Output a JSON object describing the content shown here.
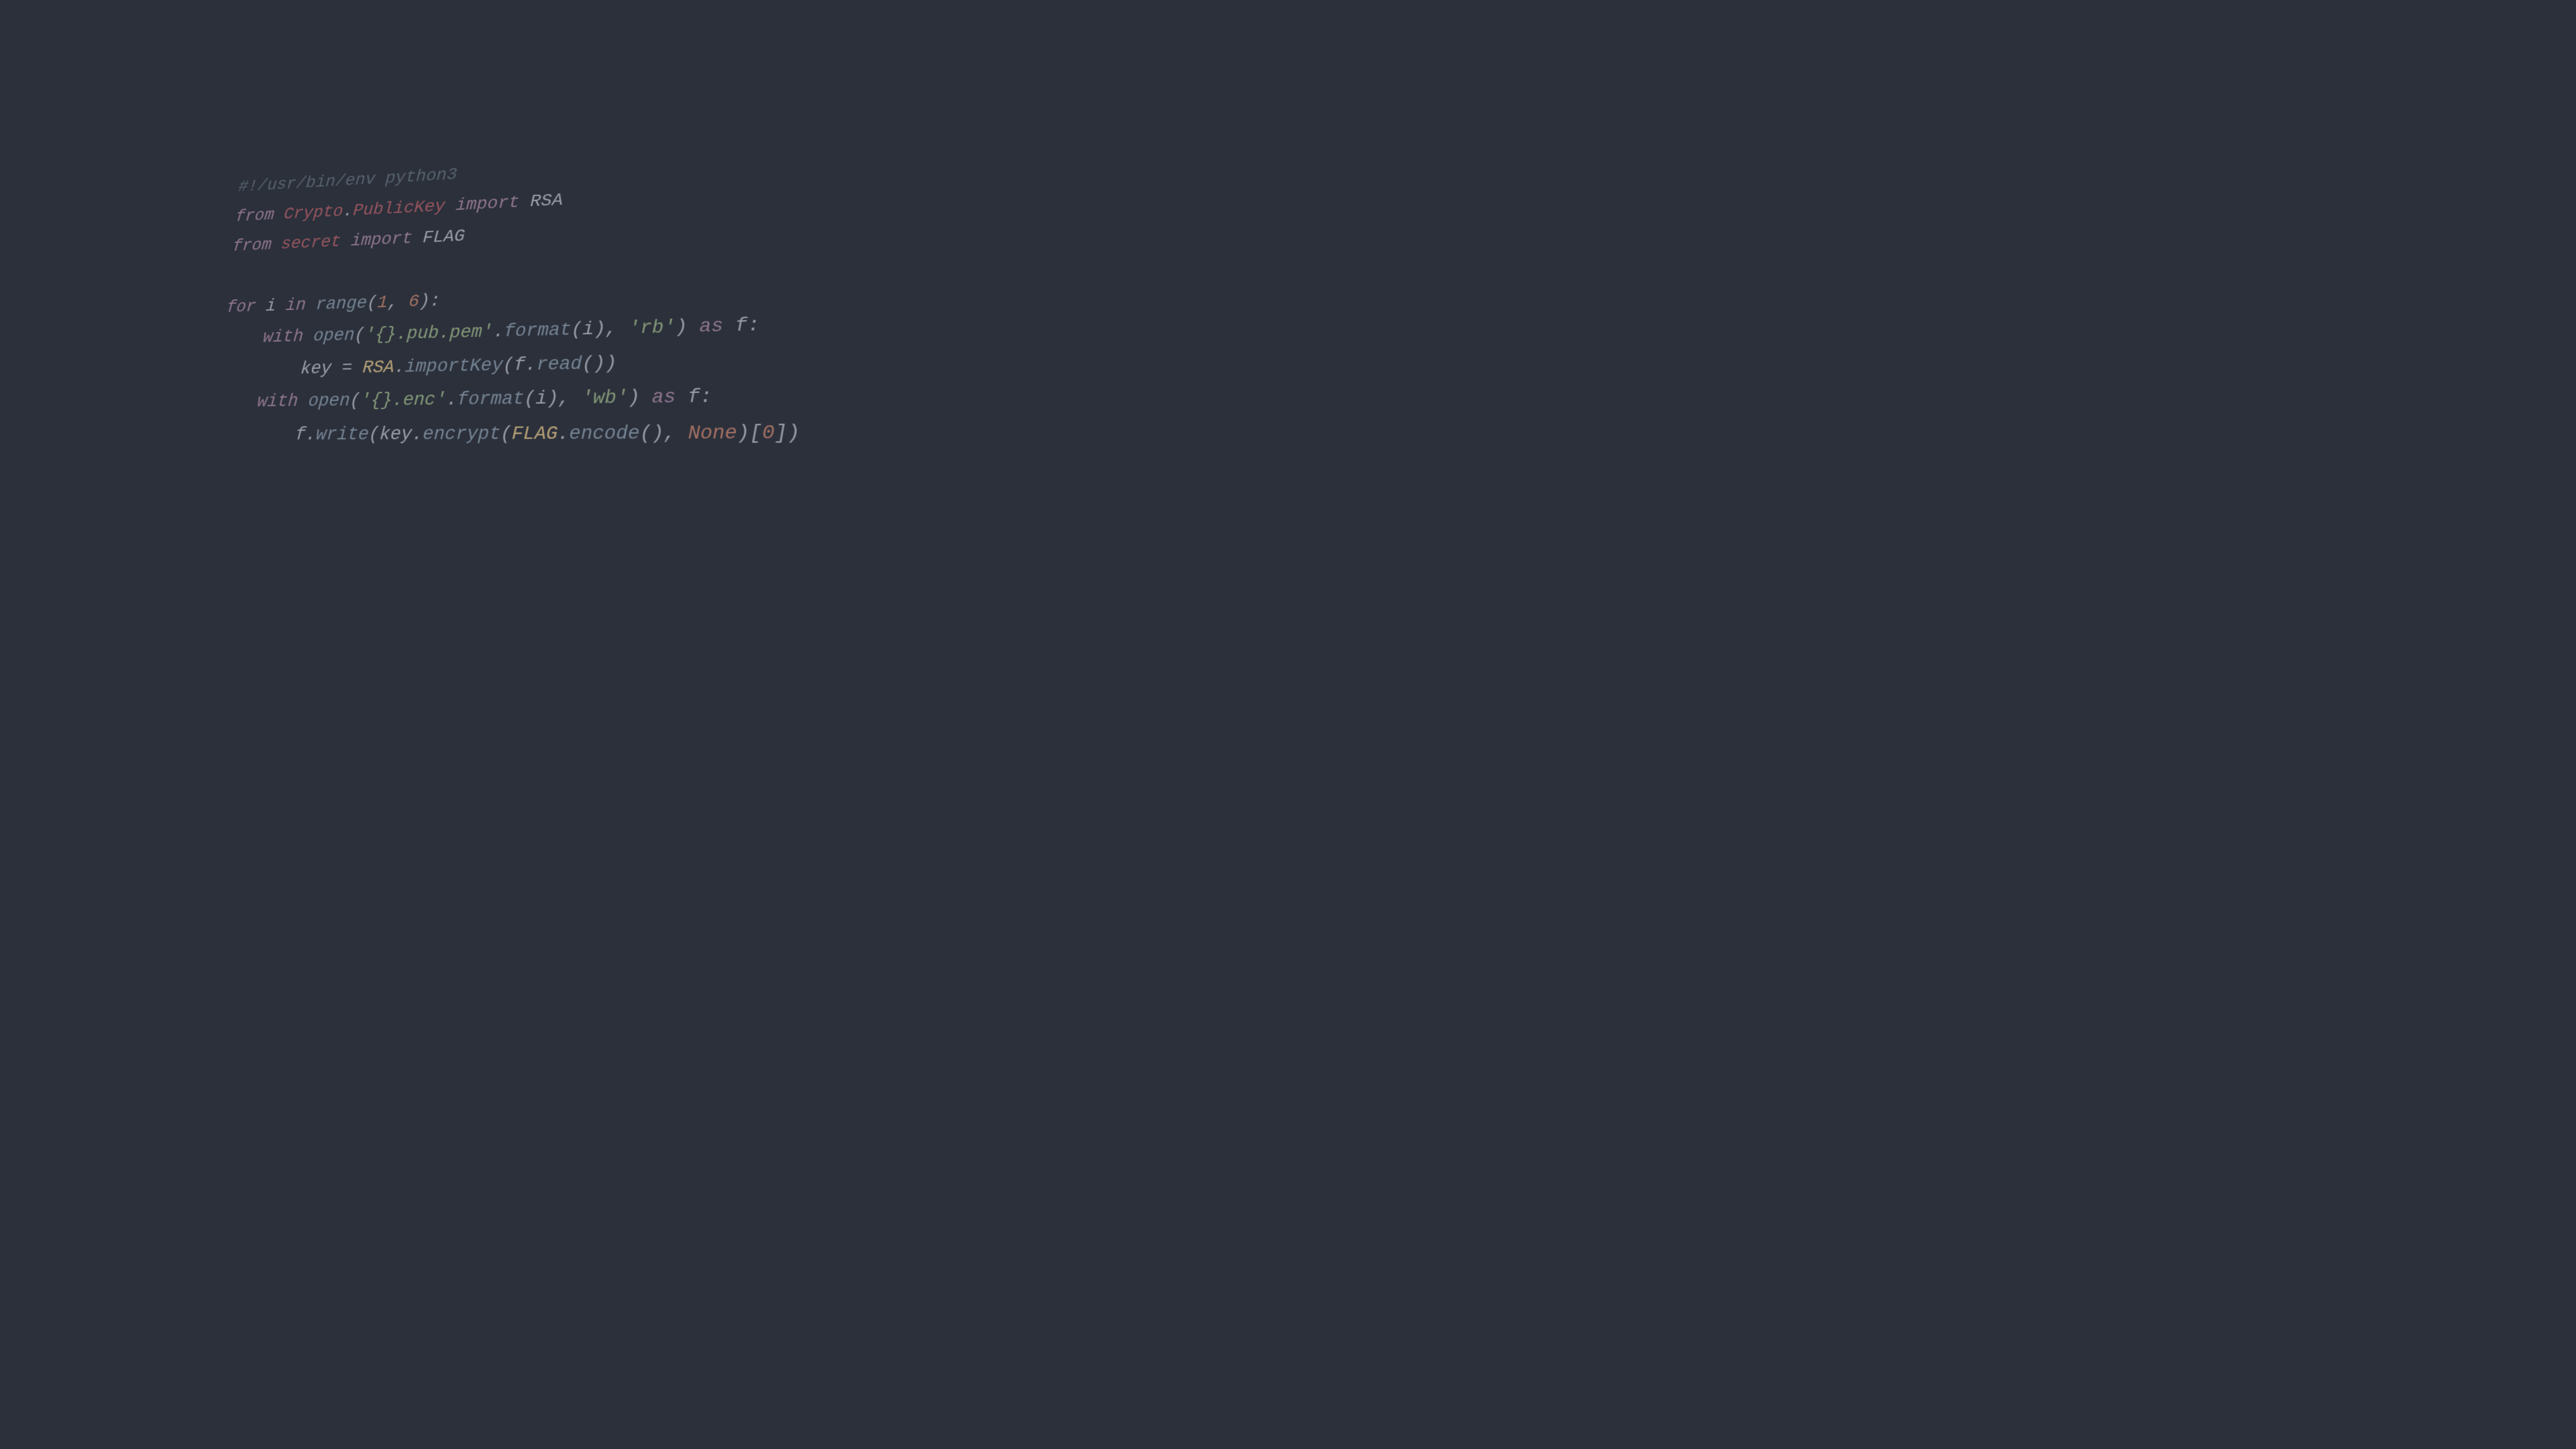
{
  "colors": {
    "background": "#2b303b",
    "comment": "#65737e",
    "keyword": "#b48ead",
    "module": "#bf616a",
    "function": "#8fa1b3",
    "string": "#a3be8c",
    "number": "#d08770",
    "class": "#ebcb8b",
    "text": "#c0c5ce"
  },
  "code": {
    "l1_shebang": "#!/usr/bin/env python3",
    "l2_from": "from ",
    "l2_crypto": "Crypto",
    "l2_dot": ".",
    "l2_publickey": "PublicKey",
    "l2_import": " import ",
    "l2_rsa": "RSA",
    "l3_from": "from ",
    "l3_secret": "secret",
    "l3_import": " import ",
    "l3_flag": "FLAG",
    "l4_blank": "",
    "l5_for": "for ",
    "l5_i": "i",
    "l5_in": " in ",
    "l5_range": "range",
    "l5_open": "(",
    "l5_one": "1",
    "l5_comma": ", ",
    "l5_six": "6",
    "l5_close": "):",
    "l6_indent": "    ",
    "l6_with": "with ",
    "l6_open": "open",
    "l6_paren": "(",
    "l6_str": "'{}.pub.pem'",
    "l6_dot": ".",
    "l6_format": "format",
    "l6_p2": "(",
    "l6_i": "i",
    "l6_p2c": "), ",
    "l6_rb": "'rb'",
    "l6_end": ") ",
    "l6_as": "as ",
    "l6_f": "f",
    "l6_colon": ":",
    "l7_indent": "        ",
    "l7_key": "key",
    "l7_eq": " = ",
    "l7_rsa": "RSA",
    "l7_dot": ".",
    "l7_importkey": "importKey",
    "l7_p1": "(",
    "l7_f": "f",
    "l7_dot2": ".",
    "l7_read": "read",
    "l7_p2": "())",
    "l8_indent": "    ",
    "l8_with": "with ",
    "l8_open": "open",
    "l8_p1": "(",
    "l8_str": "'{}.enc'",
    "l8_dot": ".",
    "l8_format": "format",
    "l8_p2": "(",
    "l8_i": "i",
    "l8_p2c": "), ",
    "l8_wb": "'wb'",
    "l8_end": ") ",
    "l8_as": "as ",
    "l8_f": "f",
    "l8_colon": ":",
    "l9_indent": "        ",
    "l9_f": "f",
    "l9_dot": ".",
    "l9_write": "write",
    "l9_p1": "(",
    "l9_key": "key",
    "l9_dot2": ".",
    "l9_encrypt": "encrypt",
    "l9_p2": "(",
    "l9_flag": "FLAG",
    "l9_dot3": ".",
    "l9_encode": "encode",
    "l9_p3": "(), ",
    "l9_none": "None",
    "l9_p4": ")[",
    "l9_zero": "0",
    "l9_p5": "])"
  }
}
